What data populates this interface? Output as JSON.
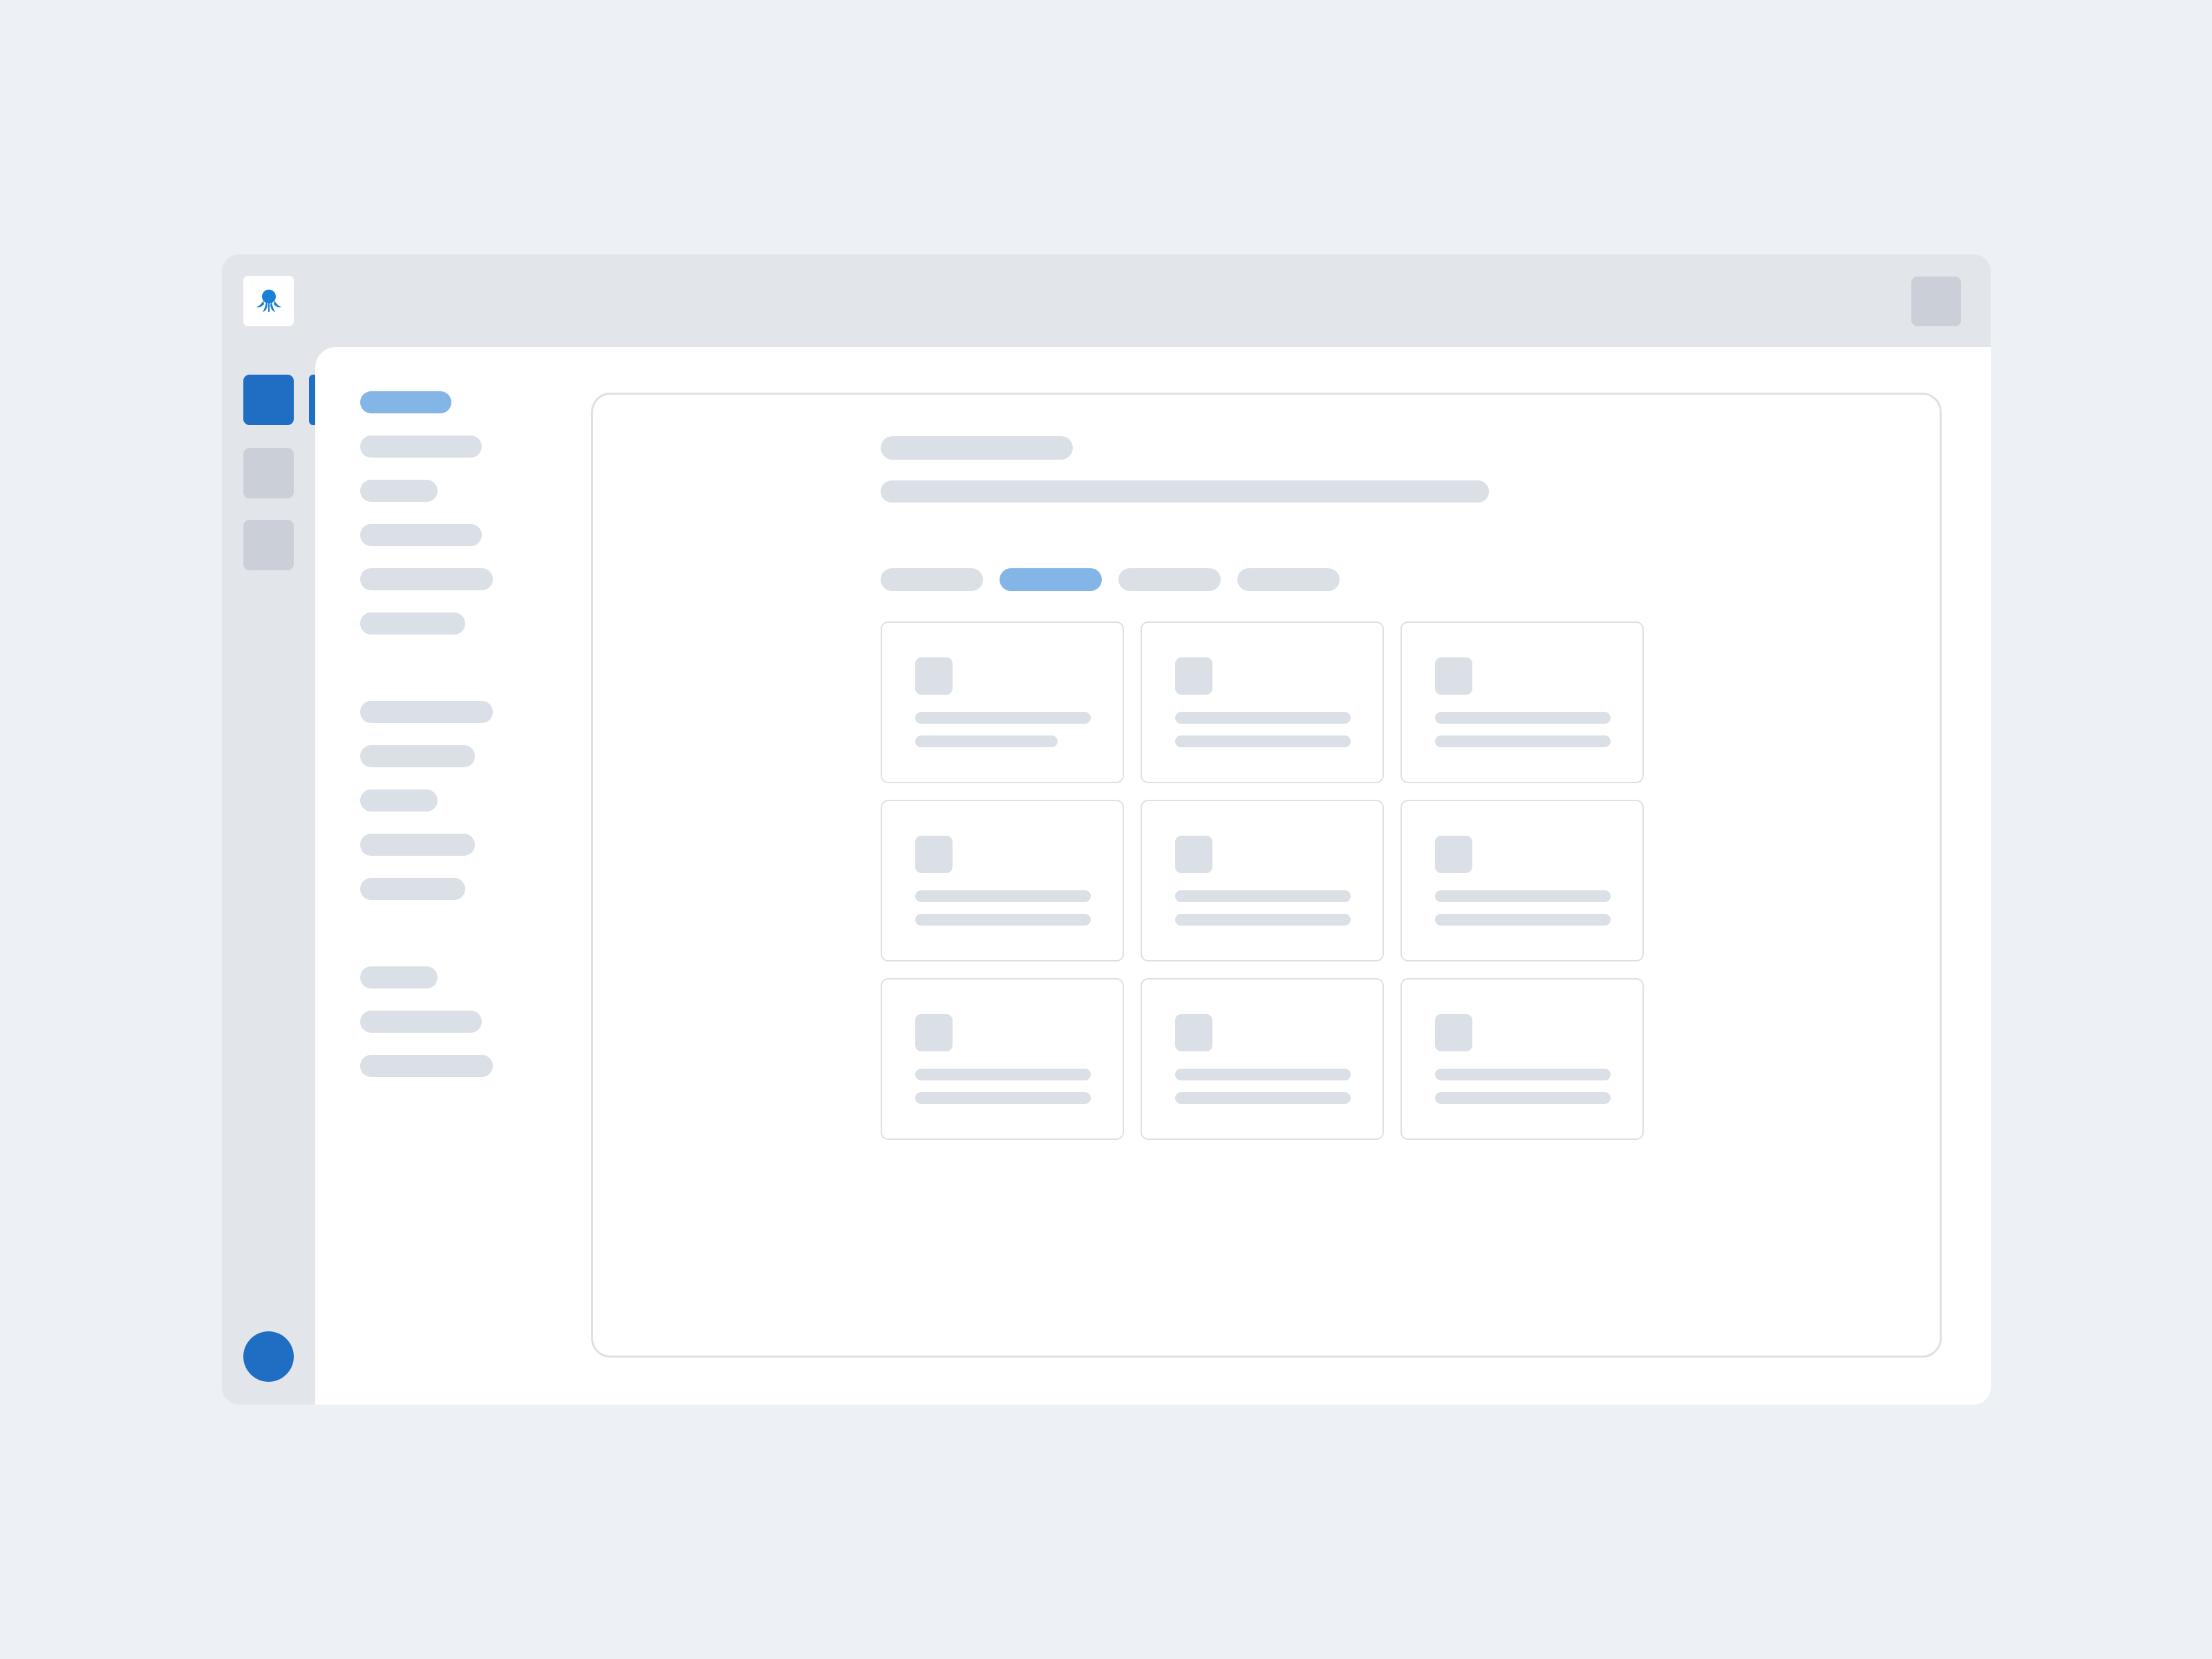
{
  "app": {
    "logo": "octopus-logo-icon"
  },
  "colors": {
    "accent": "#1f6ec4",
    "accent_light": "#83b6e7",
    "placeholder": "#dae0e6",
    "background": "#edf1f6"
  },
  "rail": {
    "item_count": 3,
    "active_index": 0
  },
  "nav": {
    "groups": [
      6,
      5,
      3
    ],
    "active_index": 0
  },
  "main": {
    "tab_count": 4,
    "active_tab": 1,
    "cards": {
      "rows": 3,
      "columns": 3
    }
  }
}
